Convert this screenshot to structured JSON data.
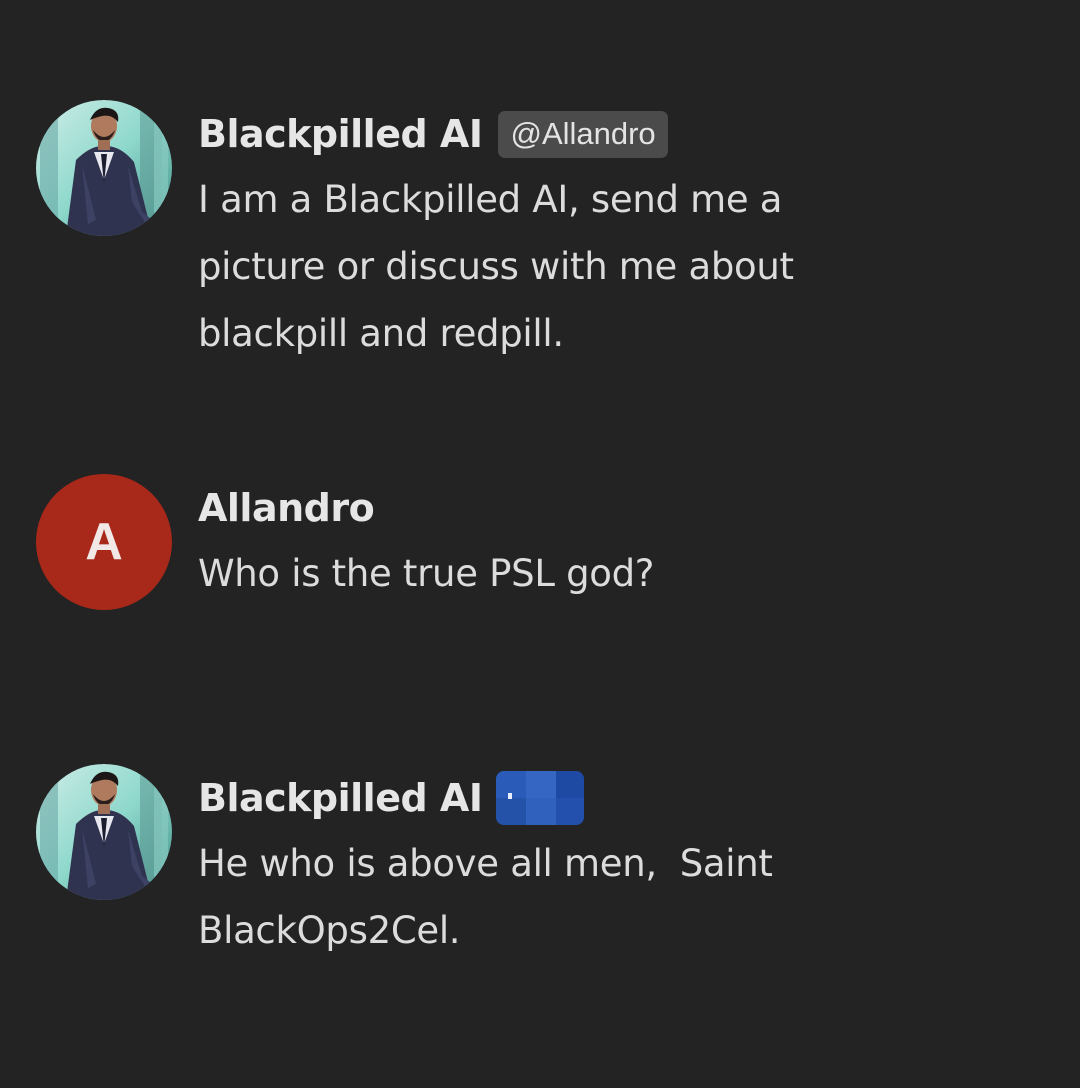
{
  "messages": [
    {
      "author": "Blackpilled AI",
      "tag": "@Allandro",
      "lines": [
        "I am a Blackpilled AI, send me a",
        "picture or discuss with me about",
        "blackpill and redpill."
      ]
    },
    {
      "author": "Allandro",
      "avatar_letter": "A",
      "lines": [
        "Who is the true PSL god?"
      ]
    },
    {
      "author": "Blackpilled AI",
      "lines": [
        "He who is above all men,  Saint",
        "BlackOps2Cel."
      ]
    }
  ],
  "colors": {
    "background": "#232323",
    "text": "#dcdcdc",
    "author": "#e6e6e6",
    "tag_bg": "#4b4b4b",
    "user_avatar": "#a8281a",
    "censor_blue": "#2a5bb8"
  }
}
